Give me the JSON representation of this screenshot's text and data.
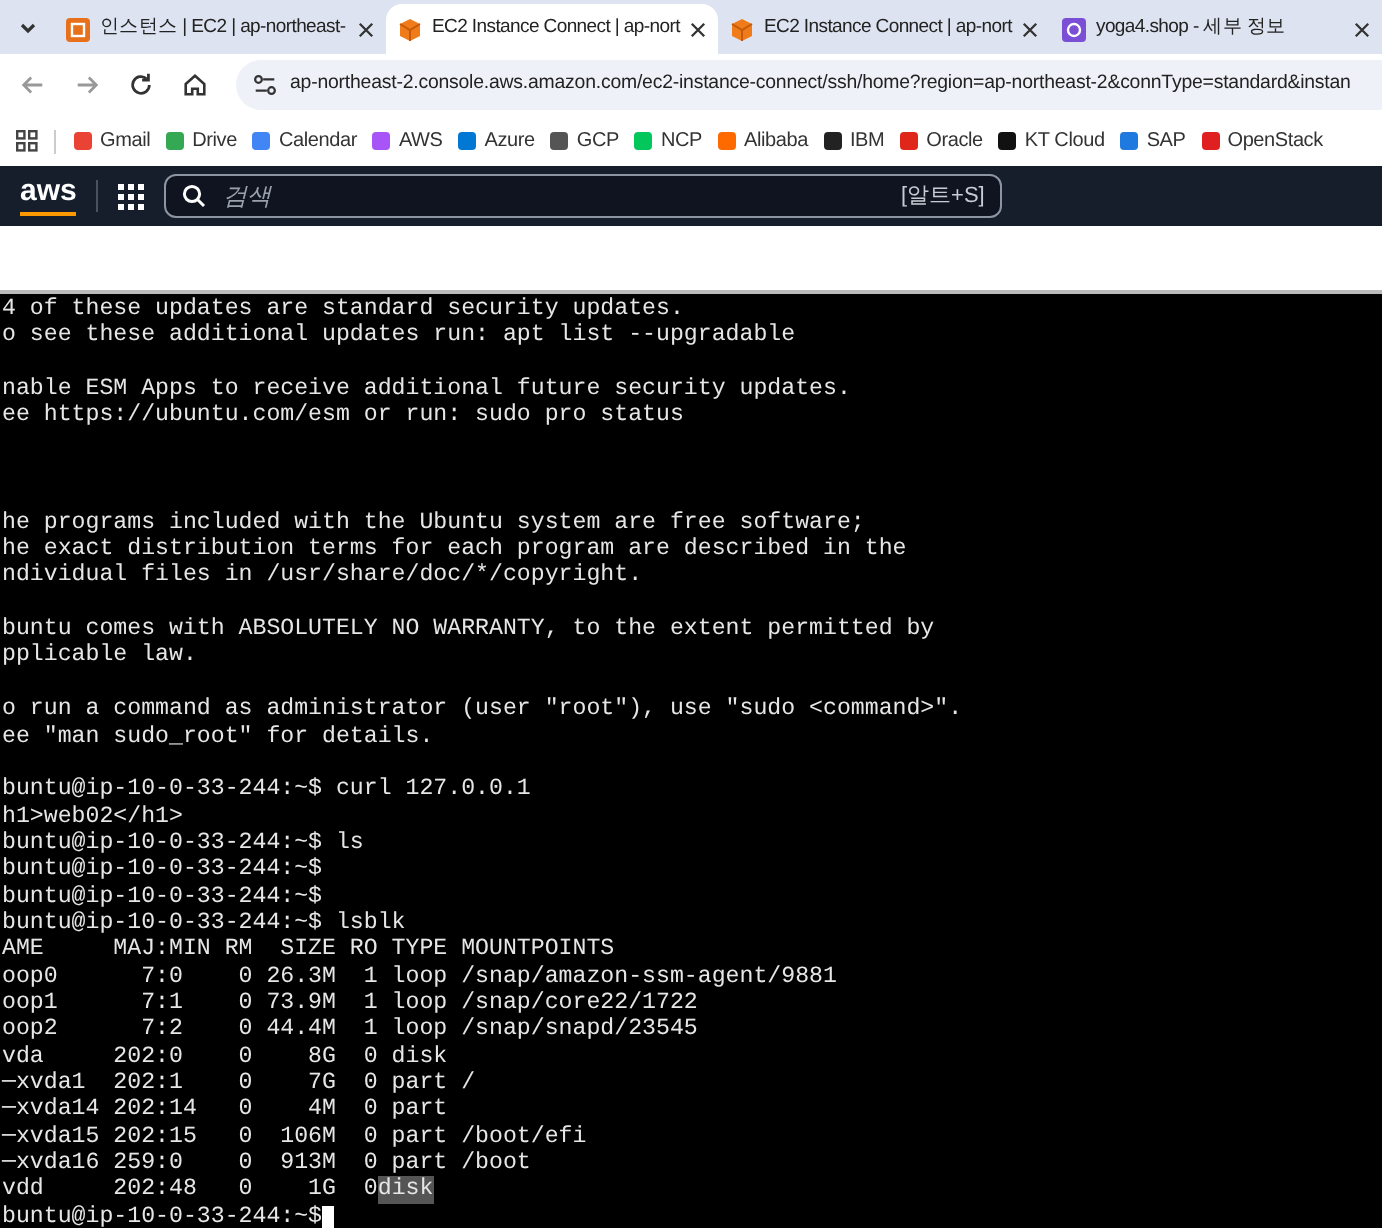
{
  "tabs": [
    {
      "title": "인스턴스 | EC2 | ap-northeast-",
      "selected": false
    },
    {
      "title": "EC2 Instance Connect | ap-nort",
      "selected": true
    },
    {
      "title": "EC2 Instance Connect | ap-nort",
      "selected": false
    },
    {
      "title": "yoga4.shop - 세부 정보",
      "selected": false
    }
  ],
  "address_bar": {
    "url": "ap-northeast-2.console.aws.amazon.com/ec2-instance-connect/ssh/home?region=ap-northeast-2&connType=standard&instan"
  },
  "bookmarks": [
    {
      "label": "Gmail",
      "color": "#ea4335"
    },
    {
      "label": "Drive",
      "color": "#34a853"
    },
    {
      "label": "Calendar",
      "color": "#4285f4"
    },
    {
      "label": "AWS",
      "color": "#a855f7"
    },
    {
      "label": "Azure",
      "color": "#0078d4"
    },
    {
      "label": "GCP",
      "color": "#555555"
    },
    {
      "label": "NCP",
      "color": "#03c75a"
    },
    {
      "label": "Alibaba",
      "color": "#ff6a00"
    },
    {
      "label": "IBM",
      "color": "#222222"
    },
    {
      "label": "Oracle",
      "color": "#e0261b"
    },
    {
      "label": "KT Cloud",
      "color": "#111111"
    },
    {
      "label": "SAP",
      "color": "#1f7ae0"
    },
    {
      "label": "OpenStack",
      "color": "#e02020"
    }
  ],
  "aws_header": {
    "logo": "aws",
    "search": {
      "placeholder": "검색",
      "shortcut": "[알트+S]"
    }
  },
  "terminal": {
    "lines": [
      {
        "kind": "text",
        "text": "4 of these updates are standard security updates."
      },
      {
        "kind": "text",
        "text": "o see these additional updates run: apt list --upgradable"
      },
      {
        "kind": "blank"
      },
      {
        "kind": "text",
        "text": "nable ESM Apps to receive additional future security updates."
      },
      {
        "kind": "text",
        "text": "ee https://ubuntu.com/esm or run: sudo pro status"
      },
      {
        "kind": "blank"
      },
      {
        "kind": "blank"
      },
      {
        "kind": "blank"
      },
      {
        "kind": "text",
        "text": "he programs included with the Ubuntu system are free software;"
      },
      {
        "kind": "text",
        "text": "he exact distribution terms for each program are described in the"
      },
      {
        "kind": "text",
        "text": "ndividual files in /usr/share/doc/*/copyright."
      },
      {
        "kind": "blank"
      },
      {
        "kind": "text",
        "text": "buntu comes with ABSOLUTELY NO WARRANTY, to the extent permitted by"
      },
      {
        "kind": "text",
        "text": "pplicable law."
      },
      {
        "kind": "blank"
      },
      {
        "kind": "text",
        "text": "o run a command as administrator (user \"root\"), use \"sudo <command>\"."
      },
      {
        "kind": "text",
        "text": "ee \"man sudo_root\" for details."
      },
      {
        "kind": "blank"
      },
      {
        "kind": "text",
        "text": "buntu@ip-10-0-33-244:~$ curl 127.0.0.1"
      },
      {
        "kind": "text",
        "text": "h1>web02</h1>"
      },
      {
        "kind": "text",
        "text": "buntu@ip-10-0-33-244:~$ ls"
      },
      {
        "kind": "text",
        "text": "buntu@ip-10-0-33-244:~$"
      },
      {
        "kind": "text",
        "text": "buntu@ip-10-0-33-244:~$"
      },
      {
        "kind": "text",
        "text": "buntu@ip-10-0-33-244:~$ lsblk"
      },
      {
        "kind": "text",
        "text": "AME     MAJ:MIN RM  SIZE RO TYPE MOUNTPOINTS"
      },
      {
        "kind": "text",
        "text": "oop0      7:0    0 26.3M  1 loop /snap/amazon-ssm-agent/9881"
      },
      {
        "kind": "text",
        "text": "oop1      7:1    0 73.9M  1 loop /snap/core22/1722"
      },
      {
        "kind": "text",
        "text": "oop2      7:2    0 44.4M  1 loop /snap/snapd/23545"
      },
      {
        "kind": "text",
        "text": "vda     202:0    0    8G  0 disk"
      },
      {
        "kind": "text",
        "text": "─xvda1  202:1    0    7G  0 part /"
      },
      {
        "kind": "text",
        "text": "─xvda14 202:14   0    4M  0 part"
      },
      {
        "kind": "text",
        "text": "─xvda15 202:15   0  106M  0 part /boot/efi"
      },
      {
        "kind": "text",
        "text": "─xvda16 259:0    0  913M  0 part /boot"
      },
      {
        "kind": "highlight",
        "text": "vdd     202:48   0    1G  0",
        "highlighted": "disk"
      },
      {
        "kind": "prompt",
        "text": "buntu@ip-10-0-33-244:~$",
        "cursor": true
      }
    ]
  }
}
